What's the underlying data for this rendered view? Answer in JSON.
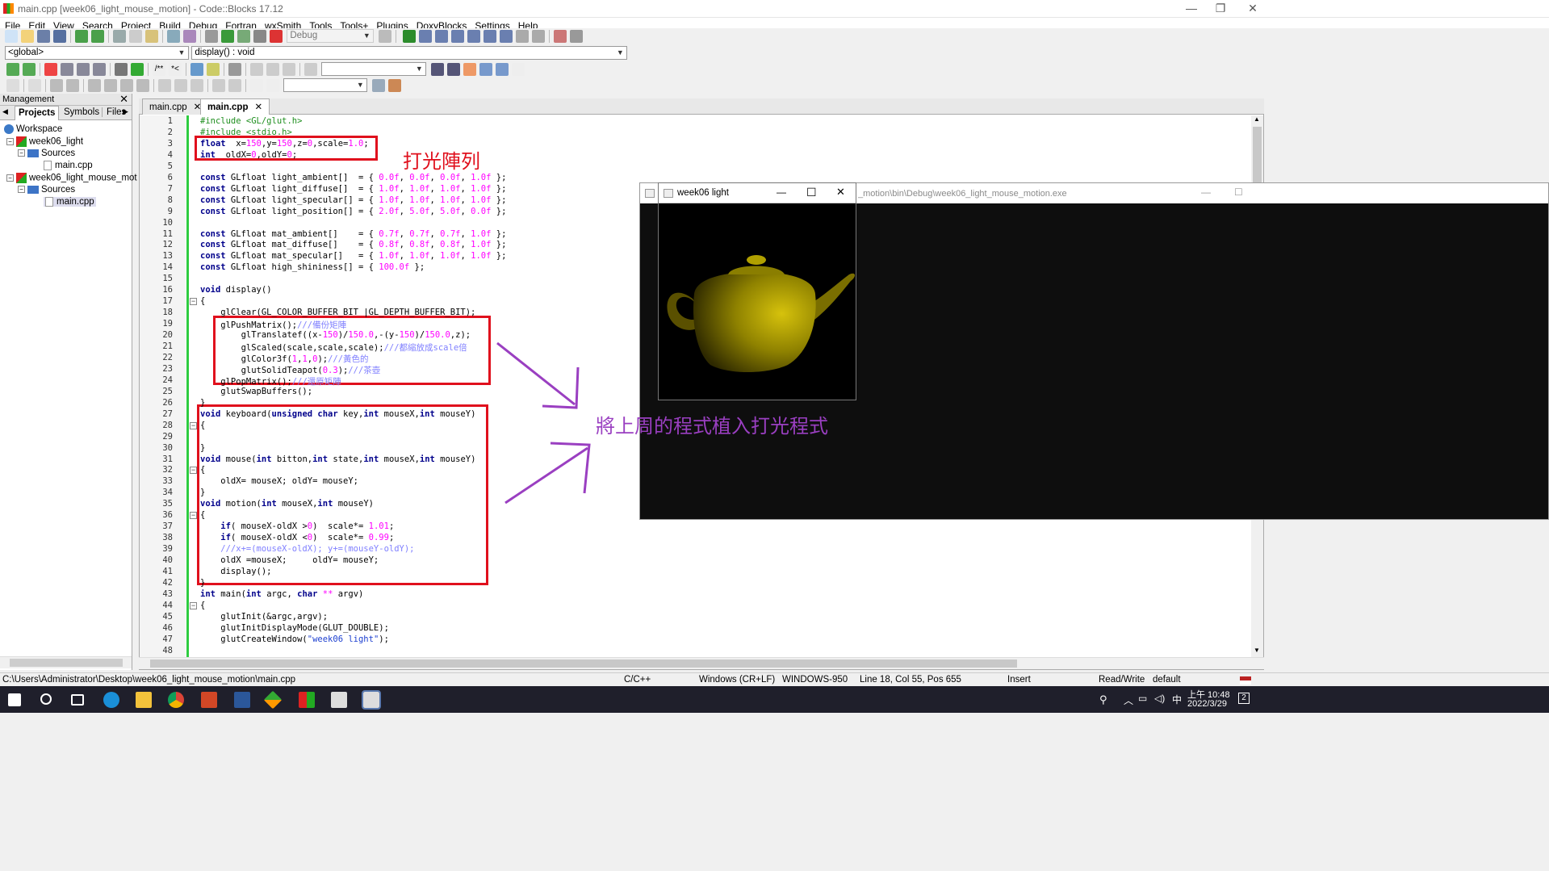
{
  "window": {
    "title": "main.cpp [week06_light_mouse_motion] - Code::Blocks 17.12",
    "min": "—",
    "max": "❐",
    "close": "✕"
  },
  "menu": [
    "File",
    "Edit",
    "View",
    "Search",
    "Project",
    "Build",
    "Debug",
    "Fortran",
    "wxSmith",
    "Tools",
    "Tools+",
    "Plugins",
    "DoxyBlocks",
    "Settings",
    "Help"
  ],
  "toolbar": {
    "build_target": "Debug",
    "scope": "<global>",
    "function": "display() : void"
  },
  "management": {
    "title": "Management",
    "close": "✕",
    "tabs": [
      "Projects",
      "Symbols",
      "Files"
    ],
    "tree": [
      {
        "label": "Workspace"
      },
      {
        "label": "week06_light",
        "toggle": "−"
      },
      {
        "label": "Sources",
        "toggle": "−"
      },
      {
        "label": "main.cpp"
      },
      {
        "label": "week06_light_mouse_mot",
        "toggle": "−"
      },
      {
        "label": "Sources",
        "toggle": "−"
      },
      {
        "label": "main.cpp"
      }
    ]
  },
  "editor": {
    "tabs": [
      {
        "label": "main.cpp",
        "close": "✕"
      },
      {
        "label": "main.cpp",
        "close": "✕"
      }
    ],
    "lines": [
      [
        [
          "pp",
          "#include <GL/glut.h>"
        ]
      ],
      [
        [
          "pp",
          "#include <stdio.h>"
        ]
      ],
      [
        [
          "kw",
          "float"
        ],
        [
          "",
          "  x="
        ],
        [
          "num",
          "150"
        ],
        [
          "",
          ",y="
        ],
        [
          "num",
          "150"
        ],
        [
          "",
          ",z="
        ],
        [
          "num",
          "0"
        ],
        [
          "",
          ",scale="
        ],
        [
          "num",
          "1.0"
        ],
        [
          "",
          ";"
        ]
      ],
      [
        [
          "kw",
          "int"
        ],
        [
          "",
          "  oldX="
        ],
        [
          "num",
          "0"
        ],
        [
          "",
          ",oldY="
        ],
        [
          "num",
          "0"
        ],
        [
          "",
          ";"
        ]
      ],
      [],
      [
        [
          "kw",
          "const"
        ],
        [
          "",
          " GLfloat light_ambient[]  = { "
        ],
        [
          "num",
          "0.0f"
        ],
        [
          "",
          ", "
        ],
        [
          "num",
          "0.0f"
        ],
        [
          "",
          ", "
        ],
        [
          "num",
          "0.0f"
        ],
        [
          "",
          ", "
        ],
        [
          "num",
          "1.0f"
        ],
        [
          "",
          " };"
        ]
      ],
      [
        [
          "kw",
          "const"
        ],
        [
          "",
          " GLfloat light_diffuse[]  = { "
        ],
        [
          "num",
          "1.0f"
        ],
        [
          "",
          ", "
        ],
        [
          "num",
          "1.0f"
        ],
        [
          "",
          ", "
        ],
        [
          "num",
          "1.0f"
        ],
        [
          "",
          ", "
        ],
        [
          "num",
          "1.0f"
        ],
        [
          "",
          " };"
        ]
      ],
      [
        [
          "kw",
          "const"
        ],
        [
          "",
          " GLfloat light_specular[] = { "
        ],
        [
          "num",
          "1.0f"
        ],
        [
          "",
          ", "
        ],
        [
          "num",
          "1.0f"
        ],
        [
          "",
          ", "
        ],
        [
          "num",
          "1.0f"
        ],
        [
          "",
          ", "
        ],
        [
          "num",
          "1.0f"
        ],
        [
          "",
          " };"
        ]
      ],
      [
        [
          "kw",
          "const"
        ],
        [
          "",
          " GLfloat light_position[] = { "
        ],
        [
          "num",
          "2.0f"
        ],
        [
          "",
          ", "
        ],
        [
          "num",
          "5.0f"
        ],
        [
          "",
          ", "
        ],
        [
          "num",
          "5.0f"
        ],
        [
          "",
          ", "
        ],
        [
          "num",
          "0.0f"
        ],
        [
          "",
          " };"
        ]
      ],
      [],
      [
        [
          "kw",
          "const"
        ],
        [
          "",
          " GLfloat mat_ambient[]    = { "
        ],
        [
          "num",
          "0.7f"
        ],
        [
          "",
          ", "
        ],
        [
          "num",
          "0.7f"
        ],
        [
          "",
          ", "
        ],
        [
          "num",
          "0.7f"
        ],
        [
          "",
          ", "
        ],
        [
          "num",
          "1.0f"
        ],
        [
          "",
          " };"
        ]
      ],
      [
        [
          "kw",
          "const"
        ],
        [
          "",
          " GLfloat mat_diffuse[]    = { "
        ],
        [
          "num",
          "0.8f"
        ],
        [
          "",
          ", "
        ],
        [
          "num",
          "0.8f"
        ],
        [
          "",
          ", "
        ],
        [
          "num",
          "0.8f"
        ],
        [
          "",
          ", "
        ],
        [
          "num",
          "1.0f"
        ],
        [
          "",
          " };"
        ]
      ],
      [
        [
          "kw",
          "const"
        ],
        [
          "",
          " GLfloat mat_specular[]   = { "
        ],
        [
          "num",
          "1.0f"
        ],
        [
          "",
          ", "
        ],
        [
          "num",
          "1.0f"
        ],
        [
          "",
          ", "
        ],
        [
          "num",
          "1.0f"
        ],
        [
          "",
          ", "
        ],
        [
          "num",
          "1.0f"
        ],
        [
          "",
          " };"
        ]
      ],
      [
        [
          "kw",
          "const"
        ],
        [
          "",
          " GLfloat high_shininess[] = { "
        ],
        [
          "num",
          "100.0f"
        ],
        [
          "",
          " };"
        ]
      ],
      [],
      [
        [
          "kw",
          "void"
        ],
        [
          "",
          " display()"
        ]
      ],
      [
        [
          "",
          "{"
        ]
      ],
      [
        [
          "",
          "    glClear(GL_COLOR_BUFFER_BIT |GL_DEPTH_BUFFER_BIT);"
        ]
      ],
      [
        [
          "",
          "    glPushMatrix();"
        ],
        [
          "cm",
          "///備份矩陣"
        ]
      ],
      [
        [
          "",
          "        glTranslatef((x-"
        ],
        [
          "num",
          "150"
        ],
        [
          "",
          ")/"
        ],
        [
          "num",
          "150.0"
        ],
        [
          "",
          ",-(y-"
        ],
        [
          "num",
          "150"
        ],
        [
          "",
          ")/"
        ],
        [
          "num",
          "150.0"
        ],
        [
          "",
          ",z);"
        ]
      ],
      [
        [
          "",
          "        glScaled(scale,scale,scale);"
        ],
        [
          "cm",
          "///都縮放成scale倍"
        ]
      ],
      [
        [
          "",
          "        glColor3f("
        ],
        [
          "num",
          "1"
        ],
        [
          "",
          ","
        ],
        [
          "num",
          "1"
        ],
        [
          "",
          ","
        ],
        [
          "num",
          "0"
        ],
        [
          "",
          ");"
        ],
        [
          "cm",
          "///黃色的"
        ]
      ],
      [
        [
          "",
          "        glutSolidTeapot("
        ],
        [
          "num",
          "0.3"
        ],
        [
          "",
          ");"
        ],
        [
          "cm",
          "///茶壺"
        ]
      ],
      [
        [
          "",
          "    glPopMatrix();"
        ],
        [
          "cm",
          "///還原矩陣"
        ]
      ],
      [
        [
          "",
          "    glutSwapBuffers();"
        ]
      ],
      [
        [
          "",
          "}"
        ]
      ],
      [
        [
          "kw",
          "void"
        ],
        [
          "",
          " keyboard("
        ],
        [
          "kw",
          "unsigned char"
        ],
        [
          "",
          " key,"
        ],
        [
          "kw",
          "int"
        ],
        [
          "",
          " mouseX,"
        ],
        [
          "kw",
          "int"
        ],
        [
          "",
          " mouseY)"
        ]
      ],
      [
        [
          "",
          "{"
        ]
      ],
      [],
      [
        [
          "",
          "}"
        ]
      ],
      [
        [
          "kw",
          "void"
        ],
        [
          "",
          " mouse("
        ],
        [
          "kw",
          "int"
        ],
        [
          "",
          " bitton,"
        ],
        [
          "kw",
          "int"
        ],
        [
          "",
          " state,"
        ],
        [
          "kw",
          "int"
        ],
        [
          "",
          " mouseX,"
        ],
        [
          "kw",
          "int"
        ],
        [
          "",
          " mouseY)"
        ]
      ],
      [
        [
          "",
          "{"
        ]
      ],
      [
        [
          "",
          "    oldX= mouseX; oldY= mouseY;"
        ]
      ],
      [
        [
          "",
          "}"
        ]
      ],
      [
        [
          "kw",
          "void"
        ],
        [
          "",
          " motion("
        ],
        [
          "kw",
          "int"
        ],
        [
          "",
          " mouseX,"
        ],
        [
          "kw",
          "int"
        ],
        [
          "",
          " mouseY)"
        ]
      ],
      [
        [
          "",
          "{"
        ]
      ],
      [
        [
          "kw",
          "    if"
        ],
        [
          "",
          "( mouseX-oldX >"
        ],
        [
          "num",
          "0"
        ],
        [
          "",
          ")  scale*= "
        ],
        [
          "num",
          "1.01"
        ],
        [
          "",
          ";"
        ]
      ],
      [
        [
          "kw",
          "    if"
        ],
        [
          "",
          "( mouseX-oldX <"
        ],
        [
          "num",
          "0"
        ],
        [
          "",
          ")  scale*= "
        ],
        [
          "num",
          "0.99"
        ],
        [
          "",
          ";"
        ]
      ],
      [
        [
          "cm",
          "    ///x+=(mouseX-oldX); y+=(mouseY-oldY);"
        ]
      ],
      [
        [
          "",
          "    oldX =mouseX;     oldY= mouseY;"
        ]
      ],
      [
        [
          "",
          "    display();"
        ]
      ],
      [
        [
          "",
          "}"
        ]
      ],
      [
        [
          "kw",
          "int"
        ],
        [
          "",
          " main("
        ],
        [
          "kw",
          "int"
        ],
        [
          "",
          " argc, "
        ],
        [
          "kw",
          "char"
        ],
        [
          "num",
          " **"
        ],
        [
          "",
          " argv)"
        ]
      ],
      [
        [
          "",
          "{"
        ]
      ],
      [
        [
          "",
          "    glutInit(&argc,argv);"
        ]
      ],
      [
        [
          "",
          "    glutInitDisplayMode(GLUT_DOUBLE);"
        ]
      ],
      [
        [
          "",
          "    glutCreateWindow("
        ],
        [
          "str",
          "\"week06 light\""
        ],
        [
          "",
          ");"
        ]
      ],
      []
    ]
  },
  "annotations": {
    "lighting_array": "打光陣列",
    "embed_note": "將上周的程式植入打光程式"
  },
  "glut_window": {
    "title": "week06 light",
    "min": "—",
    "max": "☐",
    "close": "✕"
  },
  "console_window": {
    "title": "_motion\\bin\\Debug\\week06_light_mouse_motion.exe",
    "min": "—",
    "max": "☐"
  },
  "status": {
    "path": "C:\\Users\\Administrator\\Desktop\\week06_light_mouse_motion\\main.cpp",
    "lang": "C/C++",
    "eol": "Windows (CR+LF)",
    "enc": "WINDOWS-950",
    "pos": "Line 18, Col 55, Pos 655",
    "mode": "Insert",
    "rw": "Read/Write",
    "profile": "default"
  },
  "taskbar": {
    "time": "上午 10:48",
    "date": "2022/3/29",
    "ime": "中",
    "notif": "2"
  },
  "colors": {
    "accent_red": "#e0101d",
    "annotation": "#9a3fc1",
    "teapot": "#b8a800"
  }
}
